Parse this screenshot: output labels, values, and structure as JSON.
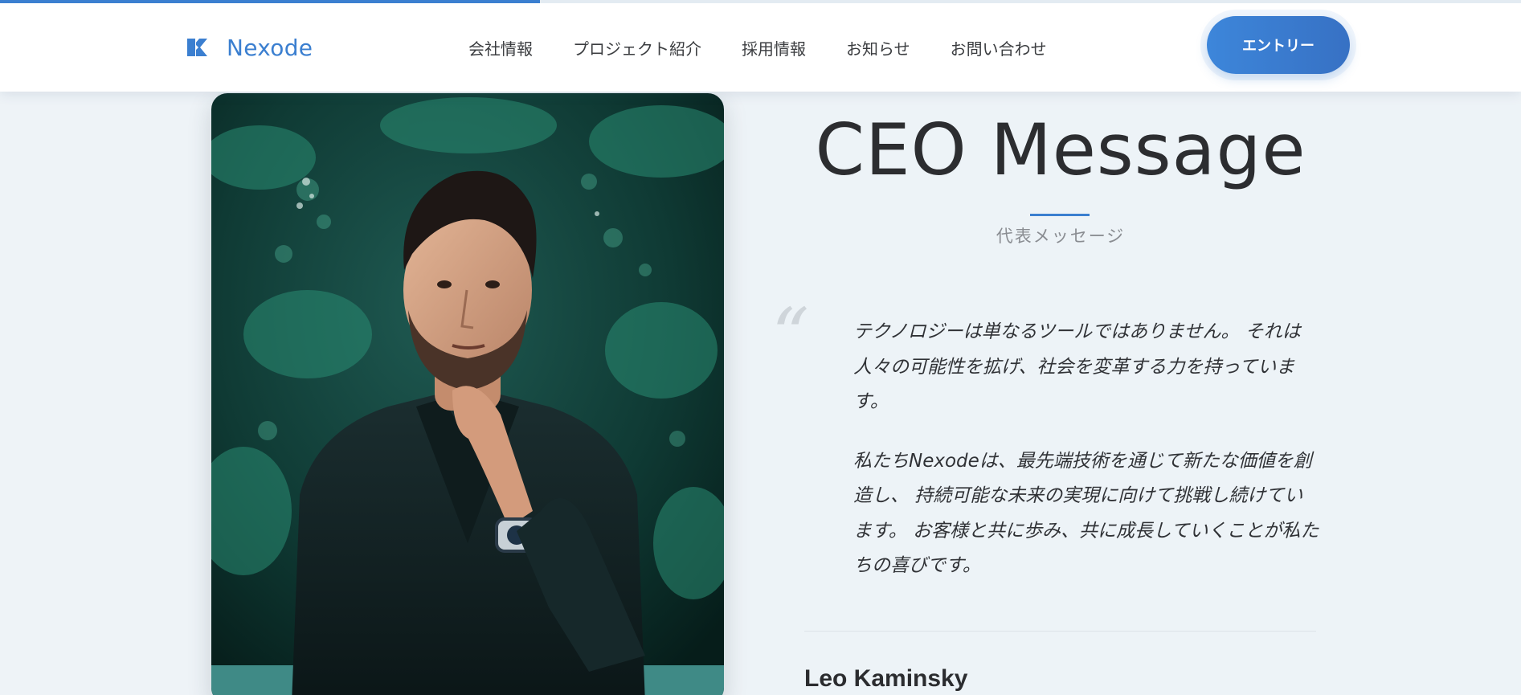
{
  "scroll_progress": 0.355,
  "colors": {
    "accent": "#3b7fd0",
    "background": "#eef3f7",
    "header_bg": "#ffffff",
    "text_dark": "#2f3134",
    "text_muted": "#8a8d92"
  },
  "header": {
    "logo_icon": "nexode-logo-icon",
    "logo_text": "Nexode",
    "nav": [
      {
        "label": "会社情報"
      },
      {
        "label": "プロジェクト紹介"
      },
      {
        "label": "採用情報"
      },
      {
        "label": "お知らせ"
      },
      {
        "label": "お問い合わせ"
      }
    ],
    "entry_button": "エントリー"
  },
  "main": {
    "photo_alt": "portrait-photo",
    "title": "CEO Message",
    "subtitle": "代表メッセージ",
    "quote_mark": "“",
    "paragraphs": [
      "テクノロジーは単なるツールではありません。 それは人々の可能性を拡げ、社会を変革する力を持っています。",
      "私たちNexodeは、最先端技術を通じて新たな価値を創造し、 持続可能な未来の実現に向けて挑戦し続けています。 お客様と共に歩み、共に成長していくことが私たちの喜びです。"
    ],
    "ceo_name": "Leo Kaminsky"
  }
}
